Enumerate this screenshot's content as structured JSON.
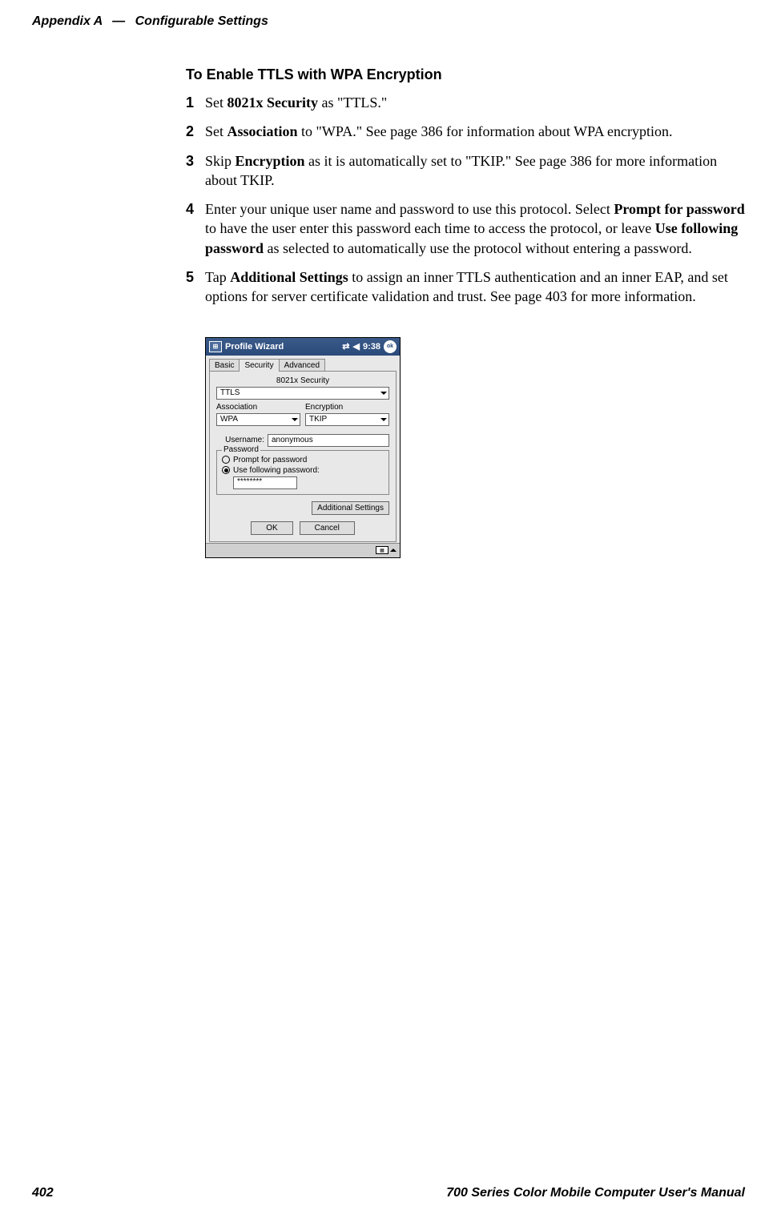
{
  "header": {
    "appendix": "Appendix  A",
    "dash": "—",
    "title": "Configurable Settings"
  },
  "content": {
    "heading": "To Enable TTLS with WPA Encryption",
    "items": [
      {
        "num": "1",
        "prefix": "Set ",
        "bold1": "8021x Security",
        "suffix1": " as \"TTLS.\""
      },
      {
        "num": "2",
        "prefix": "Set ",
        "bold1": "Association",
        "suffix1": " to \"WPA.\" See page 386 for information about WPA encryption."
      },
      {
        "num": "3",
        "prefix": "Skip ",
        "bold1": "Encryption",
        "suffix1": " as it is automatically set to \"TKIP.\" See page 386 for more information about TKIP."
      },
      {
        "num": "4",
        "prefix": "Enter your unique user name and password to use this protocol. Select ",
        "bold1": "Prompt for password",
        "mid1": " to have the user enter this password each time to access the protocol, or leave ",
        "bold2": "Use following password",
        "suffix1": " as selected to automatically use the protocol without entering a password."
      },
      {
        "num": "5",
        "prefix": "Tap ",
        "bold1": "Additional Settings",
        "suffix1": " to assign an inner TTLS authentication and an inner EAP, and set options for server certificate validation and trust. See page 403 for more information."
      }
    ]
  },
  "screenshot": {
    "titlebar": {
      "title": "Profile Wizard",
      "time": "9:38",
      "ok": "ok"
    },
    "tabs": {
      "basic": "Basic",
      "security": "Security",
      "advanced": "Advanced"
    },
    "fields": {
      "securityLabel": "8021x Security",
      "securityValue": "TTLS",
      "associationLabel": "Association",
      "associationValue": "WPA",
      "encryptionLabel": "Encryption",
      "encryptionValue": "TKIP",
      "usernameLabel": "Username:",
      "usernameValue": "anonymous",
      "passwordLegend": "Password",
      "promptLabel": "Prompt for password",
      "useFollowingLabel": "Use following password:",
      "passwordValue": "********",
      "additionalBtn": "Additional Settings",
      "okBtn": "OK",
      "cancelBtn": "Cancel"
    }
  },
  "footer": {
    "pageNum": "402",
    "manual": "700 Series Color Mobile Computer User's Manual"
  }
}
